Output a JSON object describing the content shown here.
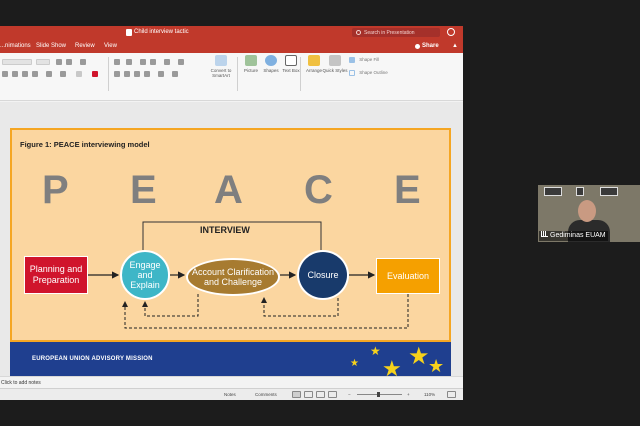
{
  "window": {
    "title": "Child interview tactic",
    "search_placeholder": "Search in Presentation"
  },
  "tabs": [
    "...nimations",
    "Slide Show",
    "Review",
    "View"
  ],
  "share_label": "Share",
  "ribbon": {
    "convert_label": "Convert to SmartArt",
    "picture_label": "Picture",
    "shapes_label": "Shapes",
    "textbox_label": "Text Box",
    "arrange_label": "Arrange",
    "quickstyles_label": "Quick Styles",
    "shapefill_label": "Shape Fill",
    "shapeoutline_label": "Shape Outline"
  },
  "slide": {
    "figure_title": "Figure 1: PEACE interviewing model",
    "letters": [
      "P",
      "E",
      "A",
      "C",
      "E"
    ],
    "interview_label": "INTERVIEW",
    "stages": {
      "planning": "Planning and Preparation",
      "engage": "Engage and Explain",
      "account": "Account Clarification and Challenge",
      "closure": "Closure",
      "evaluation": "Evaluation"
    },
    "footer_text": "EUROPEAN UNION ADVISORY MISSION",
    "colors": {
      "planning": "#d0142c",
      "engage": "#3eb6c7",
      "account": "#a77b30",
      "closure": "#183a6b",
      "evaluation": "#f5a000",
      "background": "#fbd6a0",
      "footer": "#1f3f8f"
    }
  },
  "notes_placeholder": "Click to add notes",
  "status": {
    "notes_label": "Notes",
    "comments_label": "Comments",
    "zoom": "110%"
  },
  "participant": {
    "name": "Gediminas EUAM"
  }
}
